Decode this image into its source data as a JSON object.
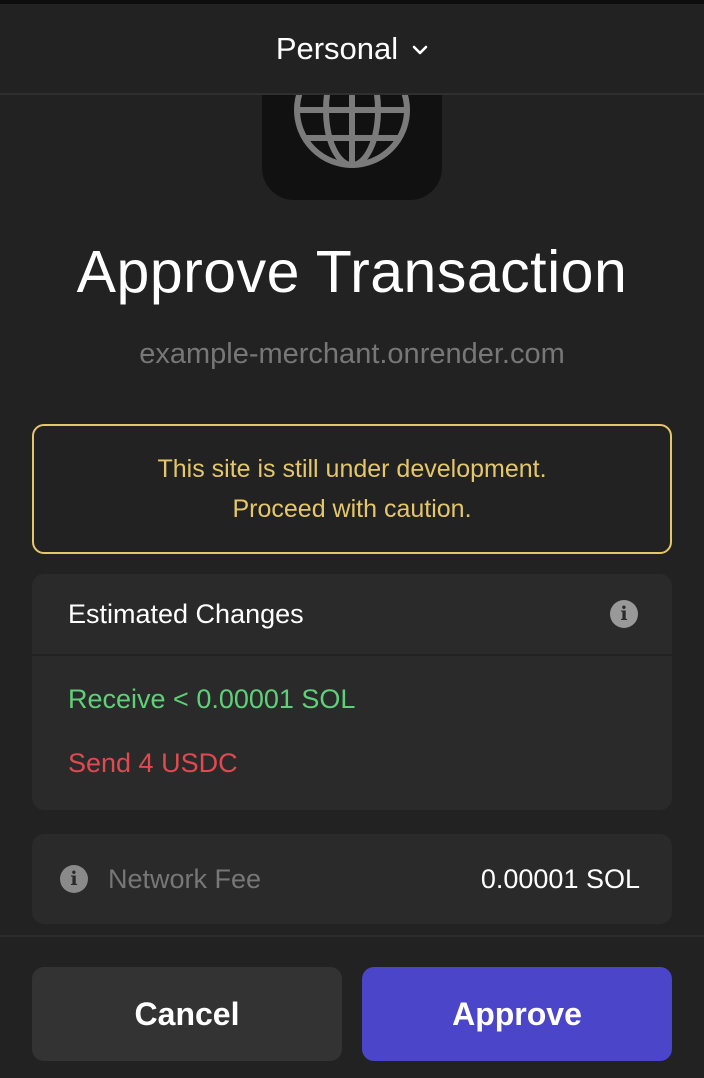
{
  "header": {
    "account_name": "Personal",
    "dropdown_icon": "chevron-down-icon"
  },
  "app": {
    "icon": "globe-icon"
  },
  "title": "Approve Transaction",
  "origin": "example-merchant.onrender.com",
  "warning": {
    "line1": "This site is still under development.",
    "line2": "Proceed with caution.",
    "color": "#e5c76b"
  },
  "estimated_changes": {
    "label": "Estimated Changes",
    "info_icon": "info-icon",
    "receive": "Receive < 0.00001 SOL",
    "send": "Send 4 USDC",
    "receive_color": "#5fcf78",
    "send_color": "#e0494f"
  },
  "network_fee": {
    "label": "Network Fee",
    "value": "0.00001 SOL"
  },
  "actions": {
    "cancel": "Cancel",
    "approve": "Approve",
    "approve_color": "#4b45c9"
  }
}
